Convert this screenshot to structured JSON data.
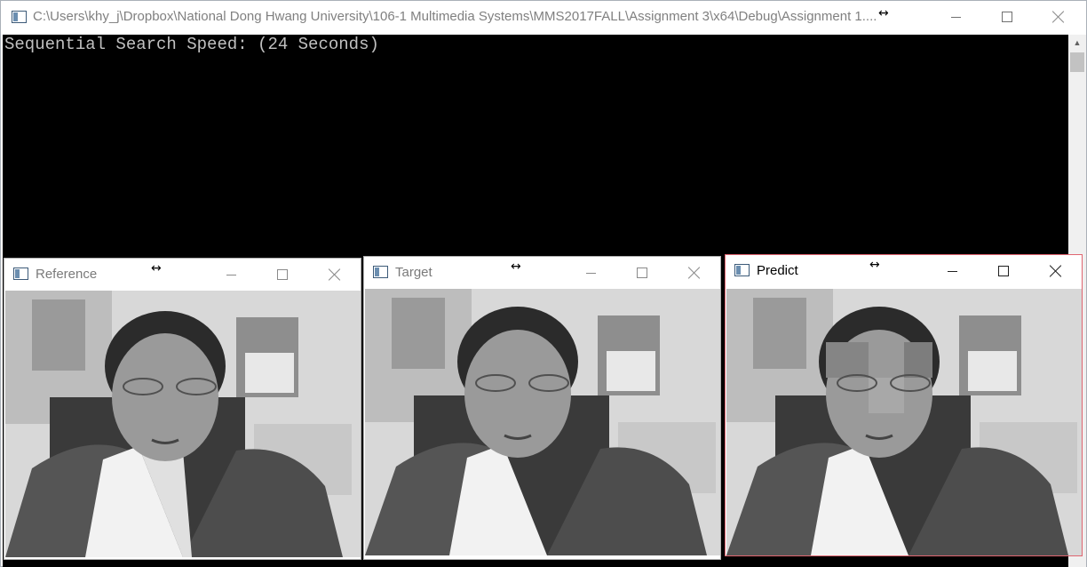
{
  "console": {
    "title": "C:\\Users\\khy_j\\Dropbox\\National Dong Hwang University\\106-1 Multimedia Systems\\MMS2017FALL\\Assignment 3\\x64\\Debug\\Assignment 1....",
    "output": "Sequential Search Speed: (24 Seconds)"
  },
  "windows": [
    {
      "title": "Reference"
    },
    {
      "title": "Target"
    },
    {
      "title": "Predict"
    }
  ],
  "colors": {
    "console_bg": "#000000",
    "console_text": "#c0c0c0",
    "active_border": "#e06570"
  },
  "icons": [
    "app-icon",
    "minimize-icon",
    "maximize-icon",
    "close-icon",
    "resize-cursor-icon"
  ]
}
